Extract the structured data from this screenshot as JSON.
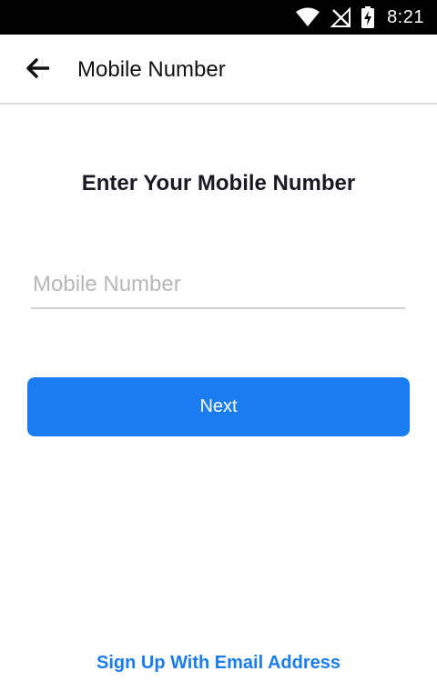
{
  "status_bar": {
    "time": "8:21",
    "icons": [
      "wifi-icon",
      "no-signal-icon",
      "battery-charging-icon"
    ]
  },
  "app_bar": {
    "back_icon": "arrow-back-icon",
    "title": "Mobile Number"
  },
  "main": {
    "heading": "Enter Your Mobile Number",
    "mobile_input": {
      "value": "",
      "placeholder": "Mobile Number"
    },
    "next_label": "Next",
    "email_link": "Sign Up With Email Address"
  },
  "colors": {
    "accent": "#1a7cf0",
    "status_bar_bg": "#000000",
    "heading_text": "#1a1a24",
    "placeholder": "#b8b8b8"
  }
}
